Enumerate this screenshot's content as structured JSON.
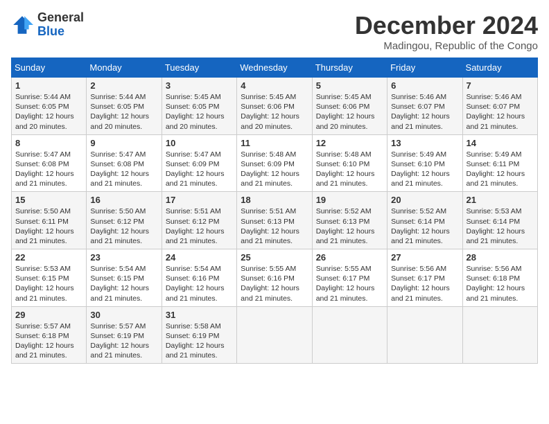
{
  "header": {
    "logo_general": "General",
    "logo_blue": "Blue",
    "month_title": "December 2024",
    "location": "Madingou, Republic of the Congo"
  },
  "weekdays": [
    "Sunday",
    "Monday",
    "Tuesday",
    "Wednesday",
    "Thursday",
    "Friday",
    "Saturday"
  ],
  "weeks": [
    [
      {
        "day": "1",
        "sunrise": "Sunrise: 5:44 AM",
        "sunset": "Sunset: 6:05 PM",
        "daylight": "Daylight: 12 hours and 20 minutes."
      },
      {
        "day": "2",
        "sunrise": "Sunrise: 5:44 AM",
        "sunset": "Sunset: 6:05 PM",
        "daylight": "Daylight: 12 hours and 20 minutes."
      },
      {
        "day": "3",
        "sunrise": "Sunrise: 5:45 AM",
        "sunset": "Sunset: 6:05 PM",
        "daylight": "Daylight: 12 hours and 20 minutes."
      },
      {
        "day": "4",
        "sunrise": "Sunrise: 5:45 AM",
        "sunset": "Sunset: 6:06 PM",
        "daylight": "Daylight: 12 hours and 20 minutes."
      },
      {
        "day": "5",
        "sunrise": "Sunrise: 5:45 AM",
        "sunset": "Sunset: 6:06 PM",
        "daylight": "Daylight: 12 hours and 20 minutes."
      },
      {
        "day": "6",
        "sunrise": "Sunrise: 5:46 AM",
        "sunset": "Sunset: 6:07 PM",
        "daylight": "Daylight: 12 hours and 21 minutes."
      },
      {
        "day": "7",
        "sunrise": "Sunrise: 5:46 AM",
        "sunset": "Sunset: 6:07 PM",
        "daylight": "Daylight: 12 hours and 21 minutes."
      }
    ],
    [
      {
        "day": "8",
        "sunrise": "Sunrise: 5:47 AM",
        "sunset": "Sunset: 6:08 PM",
        "daylight": "Daylight: 12 hours and 21 minutes."
      },
      {
        "day": "9",
        "sunrise": "Sunrise: 5:47 AM",
        "sunset": "Sunset: 6:08 PM",
        "daylight": "Daylight: 12 hours and 21 minutes."
      },
      {
        "day": "10",
        "sunrise": "Sunrise: 5:47 AM",
        "sunset": "Sunset: 6:09 PM",
        "daylight": "Daylight: 12 hours and 21 minutes."
      },
      {
        "day": "11",
        "sunrise": "Sunrise: 5:48 AM",
        "sunset": "Sunset: 6:09 PM",
        "daylight": "Daylight: 12 hours and 21 minutes."
      },
      {
        "day": "12",
        "sunrise": "Sunrise: 5:48 AM",
        "sunset": "Sunset: 6:10 PM",
        "daylight": "Daylight: 12 hours and 21 minutes."
      },
      {
        "day": "13",
        "sunrise": "Sunrise: 5:49 AM",
        "sunset": "Sunset: 6:10 PM",
        "daylight": "Daylight: 12 hours and 21 minutes."
      },
      {
        "day": "14",
        "sunrise": "Sunrise: 5:49 AM",
        "sunset": "Sunset: 6:11 PM",
        "daylight": "Daylight: 12 hours and 21 minutes."
      }
    ],
    [
      {
        "day": "15",
        "sunrise": "Sunrise: 5:50 AM",
        "sunset": "Sunset: 6:11 PM",
        "daylight": "Daylight: 12 hours and 21 minutes."
      },
      {
        "day": "16",
        "sunrise": "Sunrise: 5:50 AM",
        "sunset": "Sunset: 6:12 PM",
        "daylight": "Daylight: 12 hours and 21 minutes."
      },
      {
        "day": "17",
        "sunrise": "Sunrise: 5:51 AM",
        "sunset": "Sunset: 6:12 PM",
        "daylight": "Daylight: 12 hours and 21 minutes."
      },
      {
        "day": "18",
        "sunrise": "Sunrise: 5:51 AM",
        "sunset": "Sunset: 6:13 PM",
        "daylight": "Daylight: 12 hours and 21 minutes."
      },
      {
        "day": "19",
        "sunrise": "Sunrise: 5:52 AM",
        "sunset": "Sunset: 6:13 PM",
        "daylight": "Daylight: 12 hours and 21 minutes."
      },
      {
        "day": "20",
        "sunrise": "Sunrise: 5:52 AM",
        "sunset": "Sunset: 6:14 PM",
        "daylight": "Daylight: 12 hours and 21 minutes."
      },
      {
        "day": "21",
        "sunrise": "Sunrise: 5:53 AM",
        "sunset": "Sunset: 6:14 PM",
        "daylight": "Daylight: 12 hours and 21 minutes."
      }
    ],
    [
      {
        "day": "22",
        "sunrise": "Sunrise: 5:53 AM",
        "sunset": "Sunset: 6:15 PM",
        "daylight": "Daylight: 12 hours and 21 minutes."
      },
      {
        "day": "23",
        "sunrise": "Sunrise: 5:54 AM",
        "sunset": "Sunset: 6:15 PM",
        "daylight": "Daylight: 12 hours and 21 minutes."
      },
      {
        "day": "24",
        "sunrise": "Sunrise: 5:54 AM",
        "sunset": "Sunset: 6:16 PM",
        "daylight": "Daylight: 12 hours and 21 minutes."
      },
      {
        "day": "25",
        "sunrise": "Sunrise: 5:55 AM",
        "sunset": "Sunset: 6:16 PM",
        "daylight": "Daylight: 12 hours and 21 minutes."
      },
      {
        "day": "26",
        "sunrise": "Sunrise: 5:55 AM",
        "sunset": "Sunset: 6:17 PM",
        "daylight": "Daylight: 12 hours and 21 minutes."
      },
      {
        "day": "27",
        "sunrise": "Sunrise: 5:56 AM",
        "sunset": "Sunset: 6:17 PM",
        "daylight": "Daylight: 12 hours and 21 minutes."
      },
      {
        "day": "28",
        "sunrise": "Sunrise: 5:56 AM",
        "sunset": "Sunset: 6:18 PM",
        "daylight": "Daylight: 12 hours and 21 minutes."
      }
    ],
    [
      {
        "day": "29",
        "sunrise": "Sunrise: 5:57 AM",
        "sunset": "Sunset: 6:18 PM",
        "daylight": "Daylight: 12 hours and 21 minutes."
      },
      {
        "day": "30",
        "sunrise": "Sunrise: 5:57 AM",
        "sunset": "Sunset: 6:19 PM",
        "daylight": "Daylight: 12 hours and 21 minutes."
      },
      {
        "day": "31",
        "sunrise": "Sunrise: 5:58 AM",
        "sunset": "Sunset: 6:19 PM",
        "daylight": "Daylight: 12 hours and 21 minutes."
      },
      null,
      null,
      null,
      null
    ]
  ]
}
